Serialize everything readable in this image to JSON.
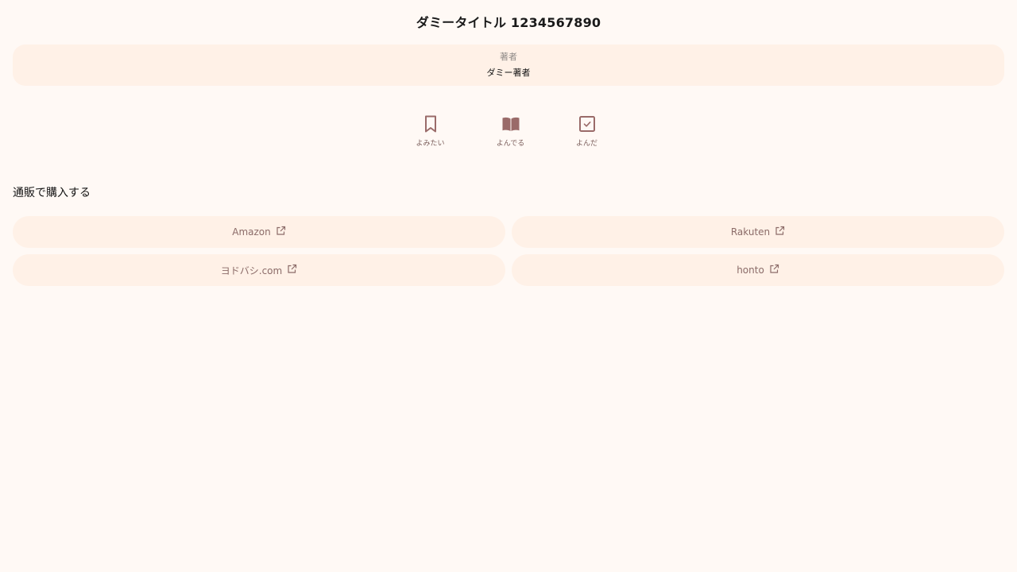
{
  "book": {
    "title": "ダミータイトル 1234567890",
    "author_label": "著者",
    "author_name": "ダミー著者"
  },
  "status_buttons": [
    {
      "label": "よみたい",
      "icon": "bookmark-icon"
    },
    {
      "label": "よんでる",
      "icon": "open-book-icon"
    },
    {
      "label": "よんだ",
      "icon": "checkbox-icon"
    }
  ],
  "shop_section": {
    "heading": "通販で購入する",
    "links": [
      {
        "label": "Amazon",
        "icon": "external-link-icon"
      },
      {
        "label": "Rakuten",
        "icon": "external-link-icon"
      },
      {
        "label": "ヨドバシ.com",
        "icon": "external-link-icon"
      },
      {
        "label": "honto",
        "icon": "external-link-icon"
      }
    ]
  },
  "colors": {
    "background": "#fff9f5",
    "card": "#fff1e7",
    "accent": "#9a6b69",
    "link_text": "#8b6b68"
  }
}
